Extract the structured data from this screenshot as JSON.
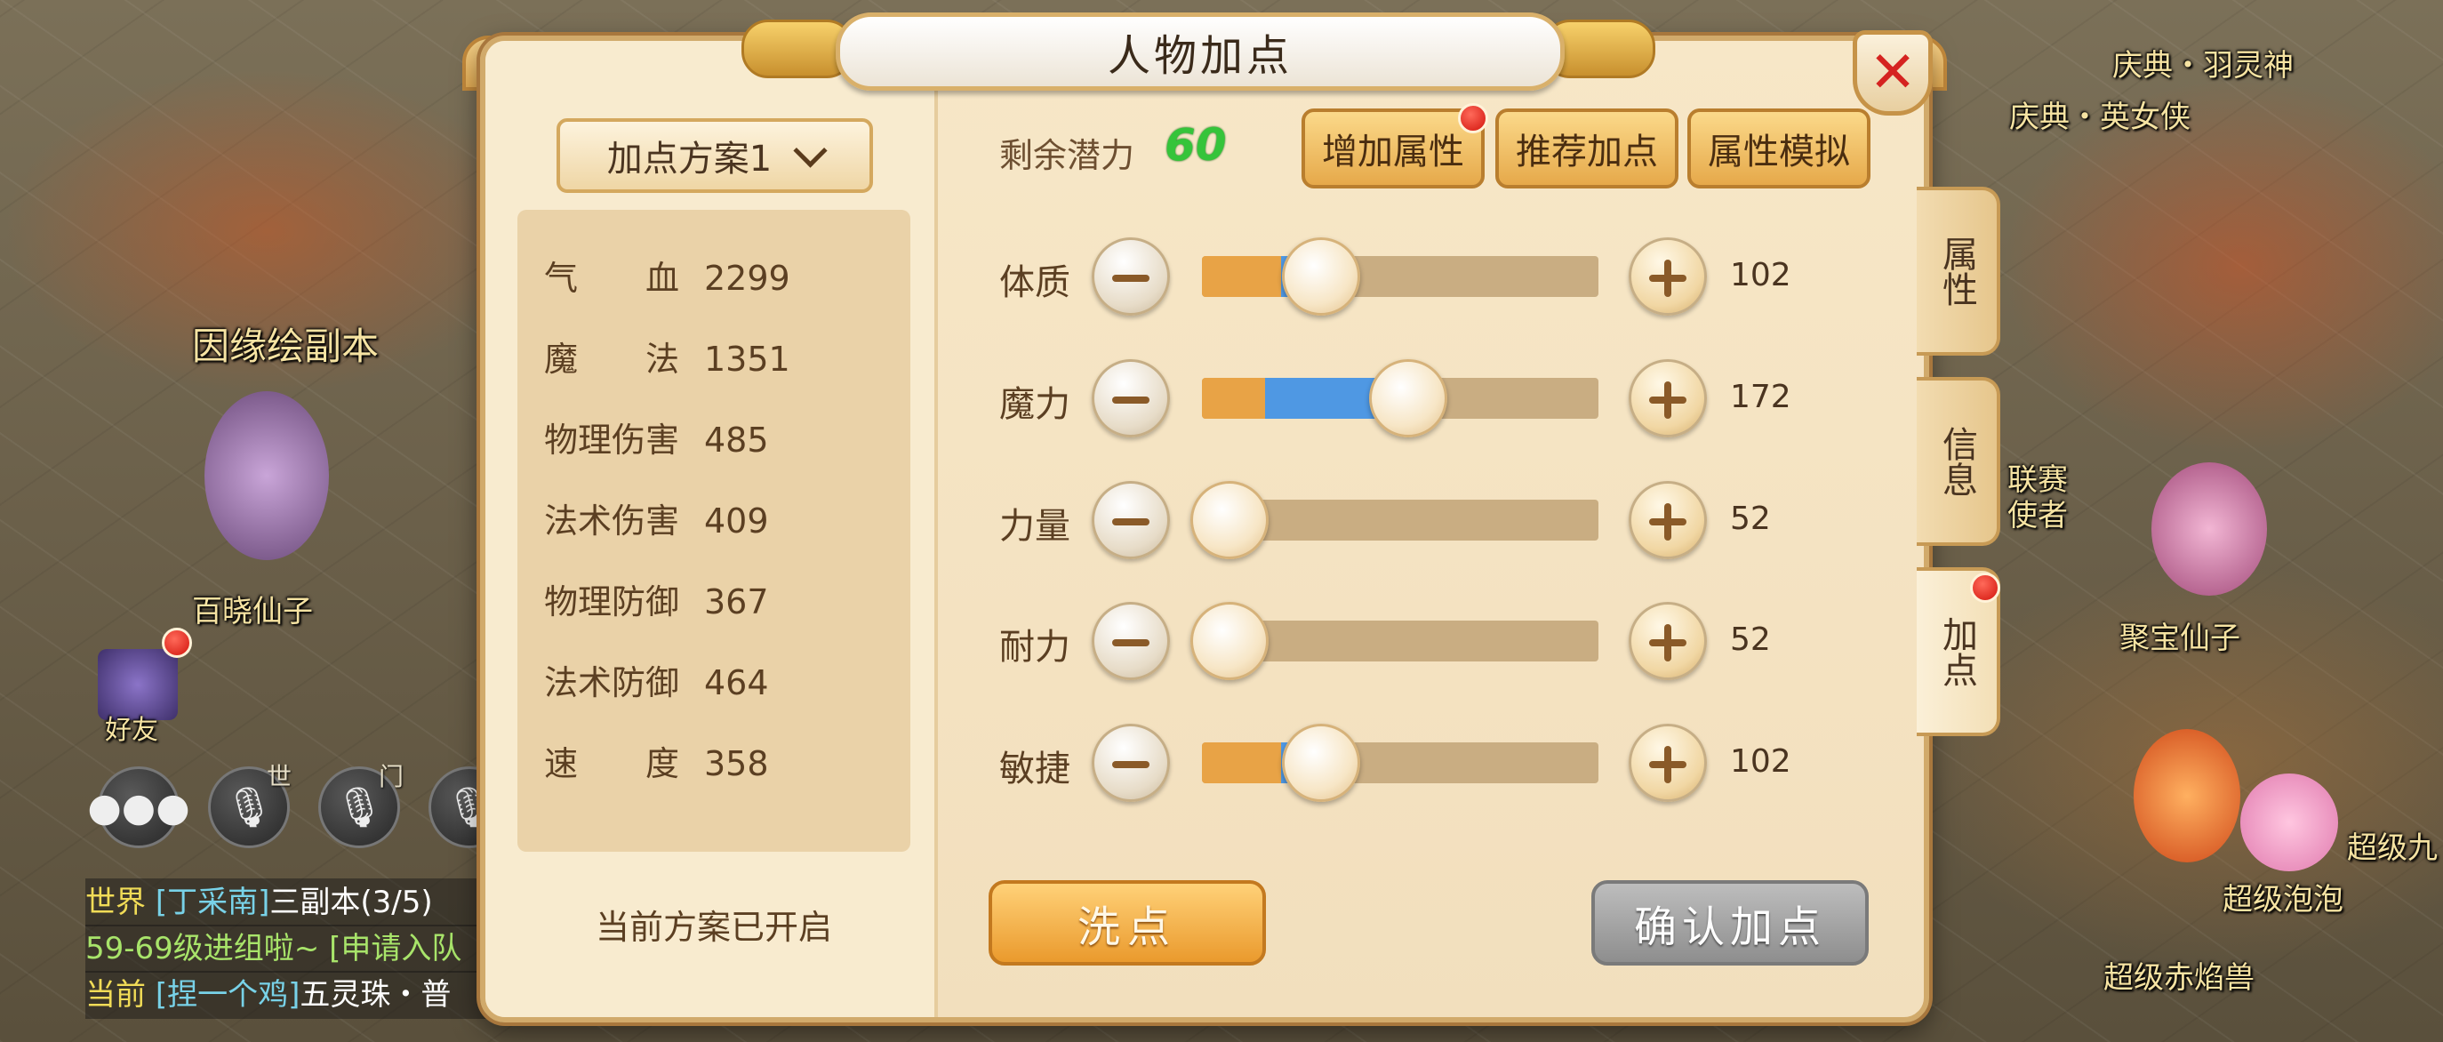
{
  "scene": {
    "npcs": [
      "庆典・羽灵神",
      "庆典・英女侠",
      "因缘绘副本",
      "百晓仙子",
      "联赛",
      "使者",
      "聚宝仙子",
      "超级九",
      "超级泡泡",
      "超级赤焰兽"
    ],
    "friend_label": "好友",
    "world_tag": "世",
    "team_tag": "门",
    "chat": [
      {
        "channel": "世界",
        "name": "[丁采南]",
        "text": "三副本(3/5)"
      },
      {
        "channel": "",
        "name": "",
        "text": "59-69级进组啦~ [申请入队"
      },
      {
        "channel": "当前",
        "name": "[捏一个鸡]",
        "text": "五灵珠・普"
      }
    ]
  },
  "panel": {
    "title": "人物加点",
    "plan_select": "加点方案1",
    "stats": [
      {
        "label": "气　　血",
        "value": "2299"
      },
      {
        "label": "魔　　法",
        "value": "1351"
      },
      {
        "label": "物理伤害",
        "value": "485"
      },
      {
        "label": "法术伤害",
        "value": "409"
      },
      {
        "label": "物理防御",
        "value": "367"
      },
      {
        "label": "法术防御",
        "value": "464"
      },
      {
        "label": "速　　度",
        "value": "358"
      }
    ],
    "plan_status": "当前方案已开启",
    "potential_label": "剩余潜力",
    "potential_value": "60",
    "top_buttons": {
      "add_attr": "增加属性",
      "recommend": "推荐加点",
      "simulate": "属性模拟"
    },
    "attributes": [
      {
        "label": "体质",
        "value": "102",
        "base_fraction": 0.2,
        "added_fraction": 0.02,
        "knob_fraction": 0.3
      },
      {
        "label": "魔力",
        "value": "172",
        "base_fraction": 0.16,
        "added_fraction": 0.34,
        "knob_fraction": 0.52
      },
      {
        "label": "力量",
        "value": "52",
        "base_fraction": 0.07,
        "added_fraction": 0.0,
        "knob_fraction": 0.07
      },
      {
        "label": "耐力",
        "value": "52",
        "base_fraction": 0.07,
        "added_fraction": 0.0,
        "knob_fraction": 0.07
      },
      {
        "label": "敏捷",
        "value": "102",
        "base_fraction": 0.2,
        "added_fraction": 0.02,
        "knob_fraction": 0.3
      }
    ],
    "wash_button": "洗点",
    "confirm_button": "确认加点",
    "side_tabs": [
      "属性",
      "信息",
      "加点"
    ]
  },
  "colors": {
    "accent_orange": "#e8a346",
    "accent_blue": "#4f98e3",
    "potential_green": "#35c43a",
    "close_red": "#d52320"
  }
}
